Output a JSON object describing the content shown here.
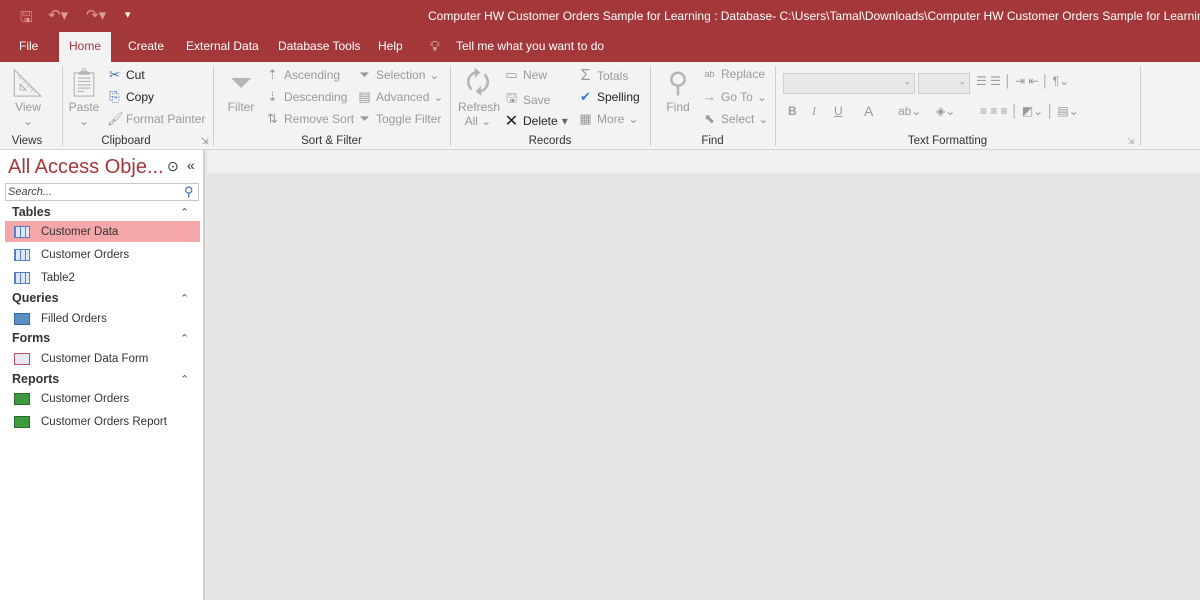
{
  "titlebar": {
    "title": "Computer HW Customer Orders Sample for Learning : Database- C:\\Users\\Tamal\\Downloads\\Computer HW Customer Orders Sample for Learning.accdb"
  },
  "tabs": [
    "File",
    "Home",
    "Create",
    "External Data",
    "Database Tools",
    "Help"
  ],
  "tell_me": "Tell me what you want to do",
  "ribbon": {
    "views": {
      "label": "Views",
      "view": "View"
    },
    "clipboard": {
      "label": "Clipboard",
      "paste": "Paste",
      "cut": "Cut",
      "copy": "Copy",
      "format_painter": "Format Painter"
    },
    "sort_filter": {
      "label": "Sort & Filter",
      "filter": "Filter",
      "ascending": "Ascending",
      "descending": "Descending",
      "remove_sort": "Remove Sort",
      "selection": "Selection",
      "advanced": "Advanced",
      "toggle_filter": "Toggle Filter"
    },
    "records": {
      "label": "Records",
      "refresh": "Refresh",
      "all": "All",
      "new": "New",
      "save": "Save",
      "delete": "Delete",
      "totals": "Totals",
      "spelling": "Spelling",
      "more": "More"
    },
    "find": {
      "label": "Find",
      "find": "Find",
      "replace": "Replace",
      "goto": "Go To",
      "select": "Select"
    },
    "text_formatting": {
      "label": "Text Formatting",
      "bold": "B",
      "italic": "I",
      "underline": "U",
      "font_color": "A"
    }
  },
  "nav": {
    "title": "All Access Obje...",
    "search_placeholder": "Search...",
    "groups": [
      {
        "name": "Tables",
        "items": [
          "Customer Data",
          "Customer Orders",
          "Table2"
        ]
      },
      {
        "name": "Queries",
        "items": [
          "Filled Orders"
        ]
      },
      {
        "name": "Forms",
        "items": [
          "Customer Data Form"
        ]
      },
      {
        "name": "Reports",
        "items": [
          "Customer Orders",
          "Customer Orders Report"
        ]
      }
    ]
  },
  "colors": {
    "accent": "#a4373a",
    "selected": "#f4a6a8"
  }
}
